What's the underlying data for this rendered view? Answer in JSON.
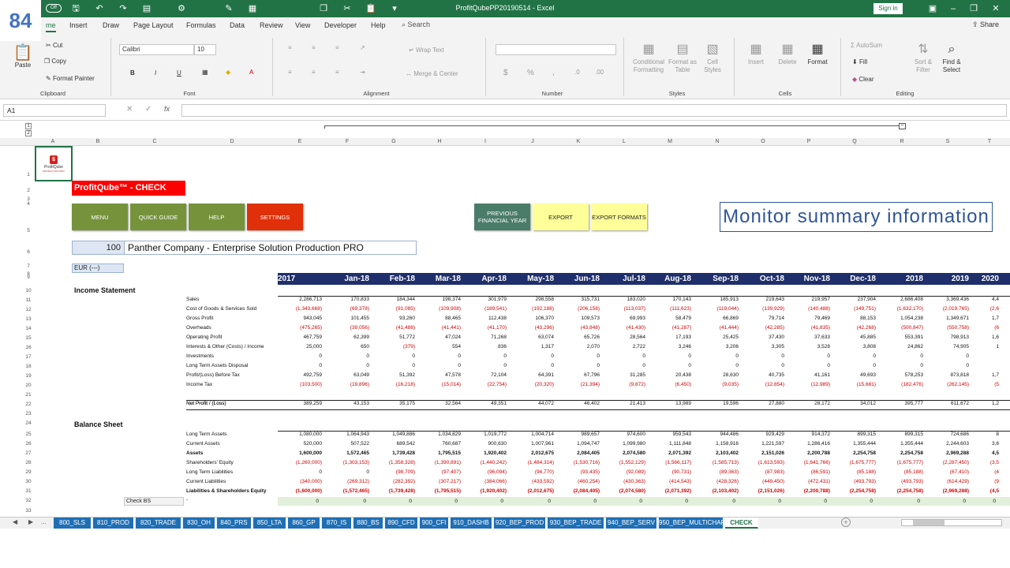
{
  "slide_number": "84",
  "titlebar": {
    "autosave": "Off",
    "title": "ProfitQubePP20190514  -  Excel",
    "sign_in": "Sign in"
  },
  "ribbon_tabs": [
    "me",
    "Insert",
    "Draw",
    "Page Layout",
    "Formulas",
    "Data",
    "Review",
    "View",
    "Developer",
    "Help"
  ],
  "search_label": "Search",
  "share_label": "Share",
  "clipboard": {
    "paste": "Paste",
    "cut": "Cut",
    "copy": "Copy",
    "format_painter": "Format Painter",
    "label": "Clipboard"
  },
  "font": {
    "name": "Calibri",
    "size": "10",
    "label": "Font"
  },
  "alignment": {
    "wrap": "Wrap Text",
    "merge": "Merge & Center",
    "label": "Alignment"
  },
  "number": {
    "label": "Number"
  },
  "styles": {
    "conditional": "Conditional Formatting",
    "format_table": "Format as Table",
    "cell_styles": "Cell Styles",
    "label": "Styles"
  },
  "cells": {
    "insert": "Insert",
    "delete": "Delete",
    "format": "Format",
    "label": "Cells"
  },
  "editing": {
    "autosum": "AutoSum",
    "fill": "Fill",
    "clear": "Clear",
    "sort": "Sort & Filter",
    "find": "Find & Select",
    "label": "Editing"
  },
  "namebox": "A1",
  "outline_levels": [
    "1",
    "2",
    "3"
  ],
  "columns": [
    "A",
    "B",
    "C",
    "D",
    "E",
    "F",
    "G",
    "H",
    "I",
    "J",
    "K",
    "L",
    "M",
    "N",
    "O",
    "P",
    "Q",
    "R",
    "S",
    "T"
  ],
  "rows": [
    "1",
    "2",
    "3",
    "4",
    "5",
    "6",
    "7",
    "8",
    "9",
    "10",
    "11",
    "12",
    "13",
    "14",
    "15",
    "16",
    "17",
    "18",
    "19",
    "20",
    "21",
    "22",
    "23",
    "24",
    "25",
    "26",
    "27",
    "28",
    "29",
    "30",
    "31",
    "32",
    "33"
  ],
  "sheet": {
    "logo_text": "ProfitQube",
    "logo_sub": "PRODUCTION PRO",
    "title": "ProfitQube™ - CHECK",
    "buttons": {
      "menu": "MENU",
      "quick_guide": "QUICK GUIDE",
      "help": "HELP",
      "settings": "SETTINGS",
      "previous_fy": "PREVIOUS FINANCIAL YEAR",
      "export": "EXPORT",
      "export_formats": "EXPORT FORMATS"
    },
    "callout": "Monitor summary information",
    "company_number": "100",
    "company_name": "Panther Company - Enterprise Solution Production PRO",
    "currency": "EUR (---)",
    "periods": [
      "2017",
      "Jan-18",
      "Feb-18",
      "Mar-18",
      "Apr-18",
      "May-18",
      "Jun-18",
      "Jul-18",
      "Aug-18",
      "Sep-18",
      "Oct-18",
      "Nov-18",
      "Dec-18",
      "2018",
      "2019",
      "2020"
    ],
    "income_statement_title": "Income Statement",
    "income_rows": [
      {
        "label": "Sales",
        "bold": false,
        "values": [
          "2,286,713",
          "170,833",
          "184,344",
          "198,374",
          "301,979",
          "298,558",
          "315,731",
          "183,020",
          "170,143",
          "185,913",
          "219,643",
          "219,957",
          "237,904",
          "2,686,408",
          "3,369,436",
          "4,4"
        ],
        "neg": false
      },
      {
        "label": "Cost of Goods & Services Sold",
        "bold": false,
        "values": [
          "(1,343,668)",
          "(69,378)",
          "(91,085)",
          "(109,908)",
          "(189,541)",
          "(192,188)",
          "(206,158)",
          "(113,037)",
          "(111,623)",
          "(119,044)",
          "(139,929)",
          "(140,488)",
          "(149,751)",
          "(1,632,170)",
          "(2,019,765)",
          "(2,6"
        ],
        "neg": true
      },
      {
        "label": "Gross Profit",
        "bold": false,
        "values": [
          "943,045",
          "101,455",
          "93,260",
          "88,465",
          "112,438",
          "106,370",
          "109,573",
          "69,993",
          "58,479",
          "66,869",
          "79,714",
          "79,469",
          "88,153",
          "1,054,238",
          "1,349,671",
          "1,7"
        ],
        "neg": false
      },
      {
        "label": "Overheads",
        "bold": false,
        "values": [
          "(475,265)",
          "(39,056)",
          "(41,488)",
          "(41,441)",
          "(41,170)",
          "(43,296)",
          "(43,848)",
          "(41,430)",
          "(41,287)",
          "(41,444)",
          "(42,285)",
          "(41,835)",
          "(42,268)",
          "(500,847)",
          "(550,758)",
          "(6"
        ],
        "neg": true
      },
      {
        "label": "Operating Profit",
        "bold": false,
        "values": [
          "467,759",
          "62,399",
          "51,772",
          "47,024",
          "71,268",
          "63,074",
          "65,726",
          "28,564",
          "17,193",
          "25,425",
          "37,430",
          "37,633",
          "45,885",
          "553,391",
          "798,913",
          "1,6"
        ],
        "neg": false
      },
      {
        "label": "Interests & Other (Costs) / Income",
        "bold": false,
        "values": [
          "25,000",
          "650",
          "(379)",
          "554",
          "836",
          "1,317",
          "2,070",
          "2,722",
          "3,246",
          "3,206",
          "3,305",
          "3,528",
          "3,808",
          "24,862",
          "74,905",
          "1"
        ],
        "neg": false,
        "neg_idx": [
          2
        ]
      },
      {
        "label": "Investments",
        "bold": false,
        "values": [
          "0",
          "0",
          "0",
          "0",
          "0",
          "0",
          "0",
          "0",
          "0",
          "0",
          "0",
          "0",
          "0",
          "0",
          "0",
          ""
        ],
        "neg": false
      },
      {
        "label": "Long Term Assets Disposal",
        "bold": false,
        "values": [
          "0",
          "0",
          "0",
          "0",
          "0",
          "0",
          "0",
          "0",
          "0",
          "0",
          "0",
          "0",
          "0",
          "0",
          "0",
          ""
        ],
        "neg": false
      },
      {
        "label": "Profit/(Loss) Before Tax",
        "bold": false,
        "values": [
          "492,759",
          "63,049",
          "51,392",
          "47,578",
          "72,104",
          "64,391",
          "67,796",
          "31,285",
          "20,438",
          "28,630",
          "40,735",
          "41,161",
          "49,693",
          "578,253",
          "873,818",
          "1,7"
        ],
        "neg": false
      },
      {
        "label": "Income Tax",
        "bold": false,
        "values": [
          "(103,500)",
          "(19,896)",
          "(16,218)",
          "(15,014)",
          "(22,754)",
          "(20,320)",
          "(21,394)",
          "(9,872)",
          "(6,450)",
          "(9,035)",
          "(12,854)",
          "(12,989)",
          "(15,681)",
          "(182,476)",
          "(262,145)",
          "(5"
        ],
        "neg": true
      }
    ],
    "net_profit": {
      "label": "Net Profit / (Loss)",
      "values": [
        "389,259",
        "43,153",
        "35,175",
        "32,564",
        "49,351",
        "44,072",
        "46,402",
        "21,413",
        "13,989",
        "19,596",
        "27,880",
        "28,172",
        "34,012",
        "395,777",
        "611,672",
        "1,2"
      ]
    },
    "balance_sheet_title": "Balance Sheet",
    "balance_rows": [
      {
        "label": "Long Term Assets",
        "bold": false,
        "values": [
          "1,080,000",
          "1,064,943",
          "1,049,886",
          "1,034,829",
          "1,019,772",
          "1,004,714",
          "989,657",
          "974,600",
          "959,543",
          "944,486",
          "929,429",
          "914,372",
          "899,315",
          "899,315",
          "724,686",
          "8"
        ],
        "neg": false
      },
      {
        "label": "Current Assets",
        "bold": false,
        "values": [
          "520,000",
          "507,522",
          "689,542",
          "760,687",
          "900,630",
          "1,007,961",
          "1,094,747",
          "1,099,980",
          "1,111,848",
          "1,158,916",
          "1,221,597",
          "1,286,416",
          "1,355,444",
          "1,355,444",
          "2,244,603",
          "3,6"
        ],
        "neg": false
      },
      {
        "label": "Assets",
        "bold": true,
        "values": [
          "1,600,000",
          "1,572,465",
          "1,739,428",
          "1,795,515",
          "1,920,402",
          "2,012,675",
          "2,084,405",
          "2,074,580",
          "2,071,392",
          "2,103,402",
          "2,151,026",
          "2,200,788",
          "2,254,758",
          "2,254,758",
          "2,969,288",
          "4,5"
        ],
        "neg": false
      },
      {
        "label": "Shareholders' Equity",
        "bold": false,
        "values": [
          "(1,260,000)",
          "(1,303,153)",
          "(1,358,328)",
          "(1,390,891)",
          "(1,440,242)",
          "(1,484,314)",
          "(1,530,716)",
          "(1,552,129)",
          "(1,566,117)",
          "(1,585,713)",
          "(1,613,593)",
          "(1,641,766)",
          "(1,675,777)",
          "(1,675,777)",
          "(2,287,450)",
          "(3,5"
        ],
        "neg": true
      },
      {
        "label": "Long Term Liabilities",
        "bold": false,
        "values": [
          "0",
          "0",
          "(98,709)",
          "(97,407)",
          "(96,094)",
          "(94,770)",
          "(93,435)",
          "(92,089)",
          "(90,731)",
          "(89,363)",
          "(87,983)",
          "(86,591)",
          "(85,188)",
          "(85,188)",
          "(67,410)",
          "(4"
        ],
        "neg": true,
        "pos_idx": [
          0,
          1
        ]
      },
      {
        "label": "Current Liabilities",
        "bold": false,
        "values": [
          "(340,000)",
          "(269,312)",
          "(282,392)",
          "(307,217)",
          "(384,066)",
          "(433,592)",
          "(460,254)",
          "(430,363)",
          "(414,543)",
          "(428,326)",
          "(449,450)",
          "(472,431)",
          "(493,793)",
          "(493,793)",
          "(614,429)",
          "(9"
        ],
        "neg": true
      },
      {
        "label": "Liabilities & Shareholders Equity",
        "bold": true,
        "values": [
          "(1,600,000)",
          "(1,572,465)",
          "(1,739,428)",
          "(1,795,515)",
          "(1,920,402)",
          "(2,012,675)",
          "(2,084,405)",
          "(2,074,580)",
          "(2,071,392)",
          "(2,103,402)",
          "(2,151,026)",
          "(2,200,788)",
          "(2,254,758)",
          "(2,254,758)",
          "(2,969,288)",
          "(4,5"
        ],
        "neg": true
      }
    ],
    "check_bs": {
      "label": "Check BS",
      "dash": "-",
      "values": [
        "0",
        "0",
        "0",
        "0",
        "0",
        "0",
        "0",
        "0",
        "0",
        "0",
        "0",
        "0",
        "0",
        "0",
        "0",
        "0"
      ]
    }
  },
  "sheet_tabs": [
    "800_SLS",
    "810_PROD",
    "820_TRADE",
    "830_OH",
    "840_PRS",
    "850_LTA",
    "860_GP",
    "870_IS",
    "880_BS",
    "890_CFD",
    "900_CFI",
    "910_DASHB",
    "920_BEP_PROD",
    "930_BEP_TRADE",
    "940_BEP_SERV",
    "950_BEP_MULTICHART",
    "CHECK"
  ],
  "active_sheet": "CHECK",
  "tab_nav_more": "..."
}
